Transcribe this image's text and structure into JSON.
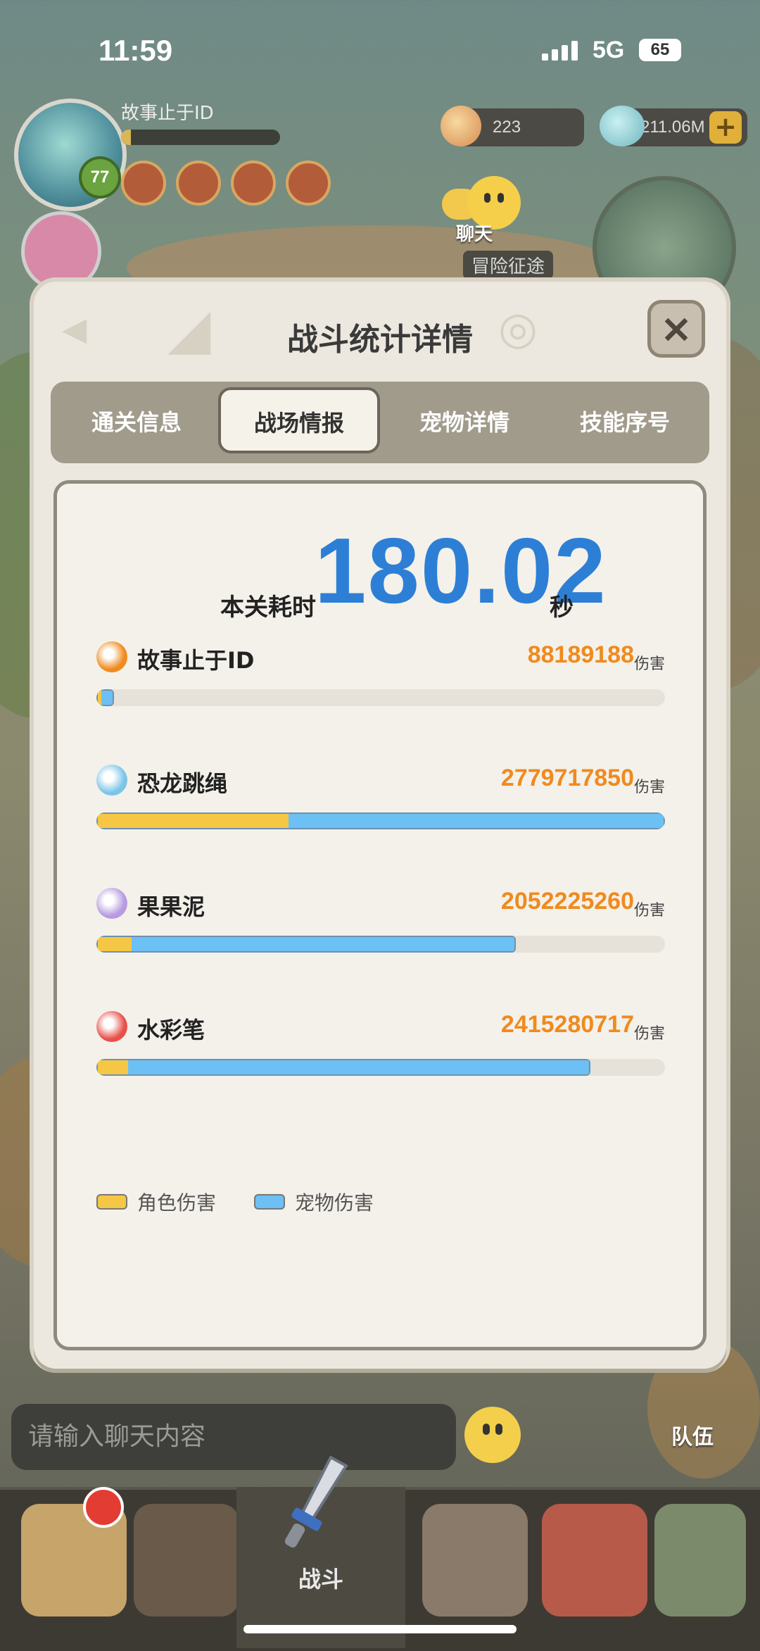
{
  "status_bar": {
    "time": "11:59",
    "network": "5G",
    "battery": "65"
  },
  "hud": {
    "player_name": "故事止于ID",
    "level": "77",
    "egg_count": "223",
    "gem_count": "211.06M",
    "chat_label": "聊天",
    "adventure_label": "冒险征途"
  },
  "dialog": {
    "title": "战斗统计详情",
    "close_symbol": "✕",
    "tabs": [
      {
        "label": "通关信息",
        "active": false
      },
      {
        "label": "战场情报",
        "active": true
      },
      {
        "label": "宠物详情",
        "active": false
      },
      {
        "label": "技能序号",
        "active": false
      }
    ],
    "time_label": "本关耗时",
    "time_value": "180.02",
    "time_unit": "秒",
    "damage_unit": "伤害",
    "rows": [
      {
        "name": "故事止于ID",
        "damage": "88189188",
        "icon": "crossed-swords-icon",
        "icon_color": "#f08a1e",
        "role_fraction": 0.007,
        "pet_fraction": 0.024
      },
      {
        "name": "恐龙跳绳",
        "damage": "2779717850",
        "icon": "dino-jumprope-icon",
        "icon_color": "#7cc5e8",
        "role_fraction": 0.337,
        "pet_fraction": 0.663
      },
      {
        "name": "果果泥",
        "damage": "2052225260",
        "icon": "swirl-icon",
        "icon_color": "#b69be0",
        "role_fraction": 0.06,
        "pet_fraction": 0.678
      },
      {
        "name": "水彩笔",
        "damage": "2415280717",
        "icon": "brush-icon",
        "icon_color": "#e8504a",
        "role_fraction": 0.053,
        "pet_fraction": 0.816
      }
    ],
    "legend": {
      "role": "角色伤害",
      "pet": "宠物伤害"
    },
    "colors": {
      "role": "#f6c744",
      "pet": "#6dc0f3",
      "time": "#2d7fd6",
      "damage": "#f08a1e"
    }
  },
  "bottom": {
    "chat_placeholder": "请输入聊天内容",
    "team_label": "队伍",
    "battle_label": "战斗"
  }
}
